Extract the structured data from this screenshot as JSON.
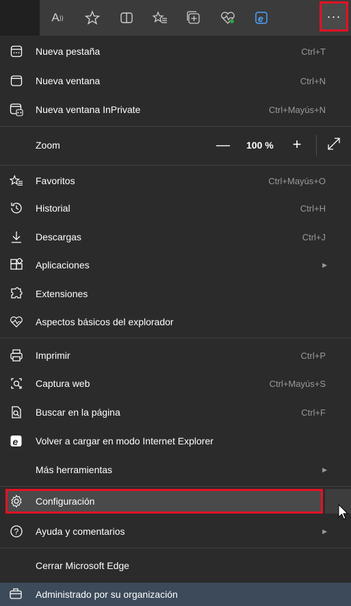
{
  "toolbar": {
    "icons": [
      "read-aloud-icon",
      "favorite-star-icon",
      "split-screen-icon",
      "favorites-icon",
      "collections-icon",
      "browser-essentials-icon",
      "internet-explorer-icon"
    ],
    "more_label": "···",
    "read_aloud_label": "A"
  },
  "menu": {
    "new_tab": {
      "label": "Nueva pestaña",
      "shortcut": "Ctrl+T"
    },
    "new_window": {
      "label": "Nueva ventana",
      "shortcut": "Ctrl+N"
    },
    "inprivate": {
      "label": "Nueva ventana InPrivate",
      "shortcut": "Ctrl+Mayús+N"
    },
    "zoom": {
      "label": "Zoom",
      "level": "100 %",
      "minus": "—",
      "plus": "+"
    },
    "favorites": {
      "label": "Favoritos",
      "shortcut": "Ctrl+Mayús+O"
    },
    "history": {
      "label": "Historial",
      "shortcut": "Ctrl+H"
    },
    "downloads": {
      "label": "Descargas",
      "shortcut": "Ctrl+J"
    },
    "apps": {
      "label": "Aplicaciones"
    },
    "extensions": {
      "label": "Extensiones"
    },
    "essentials": {
      "label": "Aspectos básicos del explorador"
    },
    "print": {
      "label": "Imprimir",
      "shortcut": "Ctrl+P"
    },
    "web_capture": {
      "label": "Captura web",
      "shortcut": "Ctrl+Mayús+S"
    },
    "find": {
      "label": "Buscar en la página",
      "shortcut": "Ctrl+F"
    },
    "ie_mode": {
      "label": "Volver a cargar en modo Internet Explorer"
    },
    "more_tools": {
      "label": "Más herramientas"
    },
    "settings": {
      "label": "Configuración"
    },
    "help": {
      "label": "Ayuda y comentarios"
    },
    "close": {
      "label": "Cerrar Microsoft Edge"
    },
    "managed": {
      "label": "Administrado por su organización"
    }
  },
  "colors": {
    "highlight": "#e81123",
    "background": "#2b2b2b",
    "managed_bg": "#3c4a5a"
  }
}
